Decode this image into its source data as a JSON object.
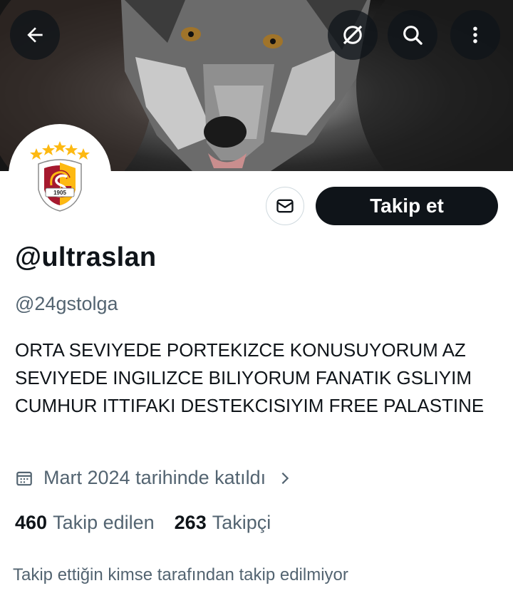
{
  "profile": {
    "display_name": "@ultraslan",
    "handle": "@24gstolga",
    "bio": "ORTA SEVIYEDE PORTEKIZCE KONUSUYORUM AZ SEVIYEDE INGILIZCE BILIYORUM FANATIK GSLIYIM  CUMHUR ITTIFAKI DESTEKCISIYIM FREE PALASTINE",
    "joined": "Mart 2024 tarihinde katıldı",
    "following_count": "460",
    "following_label": "Takip edilen",
    "followers_count": "263",
    "followers_label": "Takipçi",
    "not_followed_notice": "Takip ettiğin kimse tarafından takip edilmiyor",
    "avatar_text": "1905"
  },
  "actions": {
    "follow_label": "Takip et"
  },
  "icons": {
    "back": "arrow-left-icon",
    "grok": "grok-slash-icon",
    "search": "search-icon",
    "more": "more-vertical-icon",
    "message": "envelope-icon",
    "calendar": "calendar-icon",
    "chevron": "chevron-right-icon"
  },
  "colors": {
    "primary_text": "#0f1419",
    "secondary_text": "#536471",
    "button_bg": "#0f1419",
    "border": "#cfd9de",
    "club_red": "#a6192e",
    "club_gold": "#fdb912"
  }
}
